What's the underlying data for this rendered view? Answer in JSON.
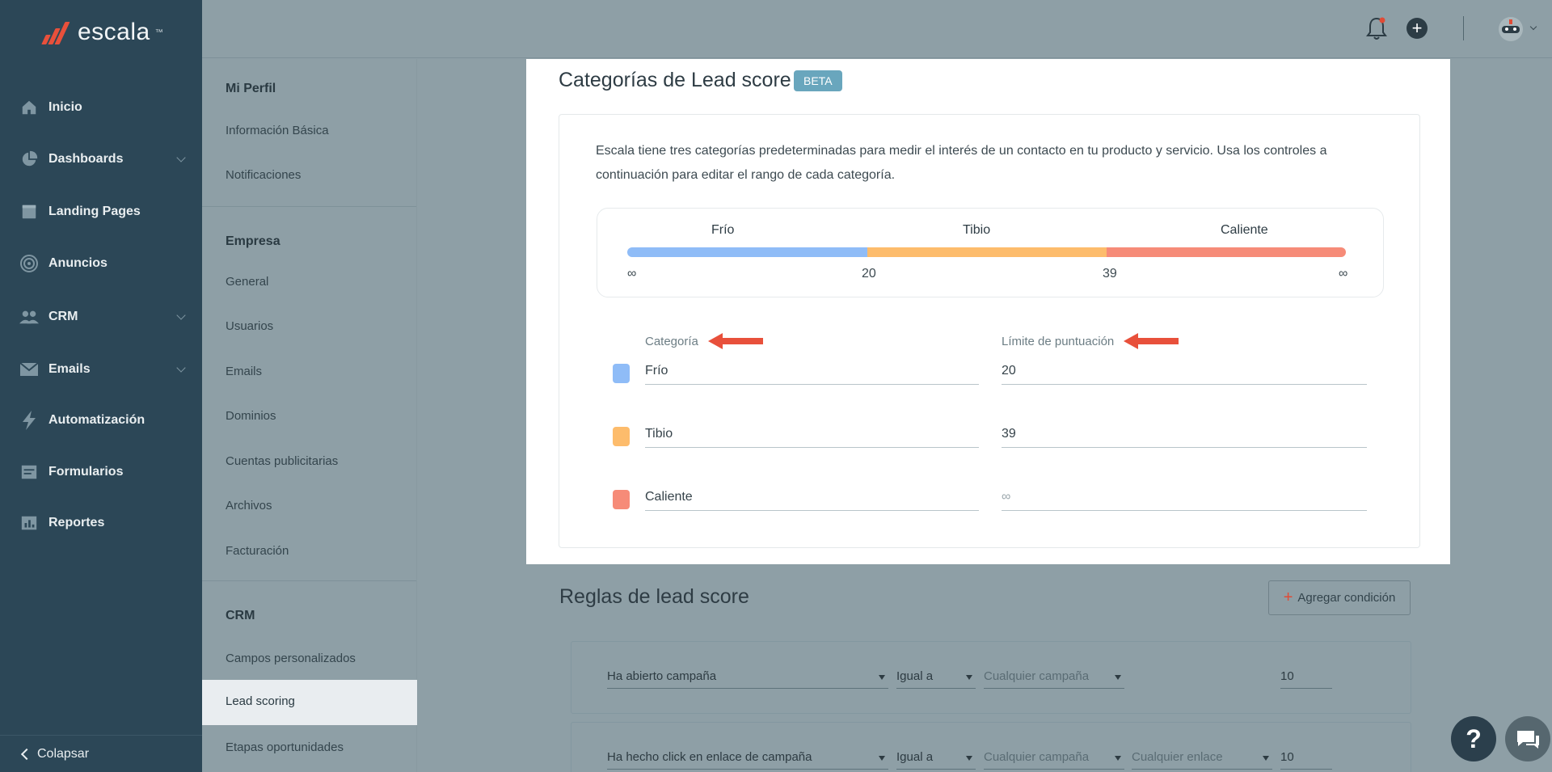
{
  "brand": {
    "name": "escala",
    "tm": "™"
  },
  "nav": {
    "items": [
      {
        "label": "Inicio",
        "icon": "home-icon",
        "expandable": false
      },
      {
        "label": "Dashboards",
        "icon": "pie-chart-icon",
        "expandable": true
      },
      {
        "label": "Landing Pages",
        "icon": "page-icon",
        "expandable": false
      },
      {
        "label": "Anuncios",
        "icon": "target-icon",
        "expandable": false
      },
      {
        "label": "CRM",
        "icon": "users-icon",
        "expandable": true
      },
      {
        "label": "Emails",
        "icon": "mail-icon",
        "expandable": true
      },
      {
        "label": "Automatización",
        "icon": "bolt-icon",
        "expandable": false
      },
      {
        "label": "Formularios",
        "icon": "form-icon",
        "expandable": false
      },
      {
        "label": "Reportes",
        "icon": "report-icon",
        "expandable": false
      }
    ],
    "collapse_label": "Colapsar"
  },
  "topbar": {
    "icons": [
      "bell-icon",
      "plus-circle-icon",
      "avatar-icon"
    ]
  },
  "subnav": {
    "sections": [
      {
        "title": "Mi Perfil",
        "items": [
          "Información Básica",
          "Notificaciones"
        ]
      },
      {
        "title": "Empresa",
        "items": [
          "General",
          "Usuarios",
          "Emails",
          "Dominios",
          "Cuentas publicitarias",
          "Archivos",
          "Facturación"
        ]
      },
      {
        "title": "CRM",
        "items": [
          "Campos personalizados",
          "Lead scoring",
          "Etapas oportunidades"
        ]
      }
    ],
    "active": "Lead scoring"
  },
  "modal": {
    "title": "Categorías de Lead score",
    "badge": "BETA",
    "description": "Escala tiene tres categorías predeterminadas para medir el interés de un contacto en tu producto y servicio. Usa los controles a continuación para editar el rango de cada categoría.",
    "range": {
      "labels": [
        "Frío",
        "Tibio",
        "Caliente"
      ],
      "ticks": [
        "∞",
        "20",
        "39",
        "∞"
      ],
      "colors": [
        "#8fbcf7",
        "#fdbc6c",
        "#f68b78"
      ]
    },
    "columns": {
      "category": "Categoría",
      "limit": "Límite de puntuación"
    },
    "rows": [
      {
        "name": "Frío",
        "limit": "20",
        "color": "#8fbcf7"
      },
      {
        "name": "Tibio",
        "limit": "39",
        "color": "#fdbc6c"
      },
      {
        "name": "Caliente",
        "limit": "∞",
        "color": "#f68b78"
      }
    ]
  },
  "rules": {
    "title": "Reglas de lead score",
    "add_button": "Agregar condición",
    "rows": [
      {
        "event": "Ha abierto campaña",
        "op": "Igual a",
        "campaign": "Cualquier campaña",
        "link": "",
        "points": "10"
      },
      {
        "event": "Ha hecho click en enlace de campaña",
        "op": "Igual a",
        "campaign": "Cualquier campaña",
        "link": "Cualquier enlace",
        "points": "10"
      }
    ]
  }
}
